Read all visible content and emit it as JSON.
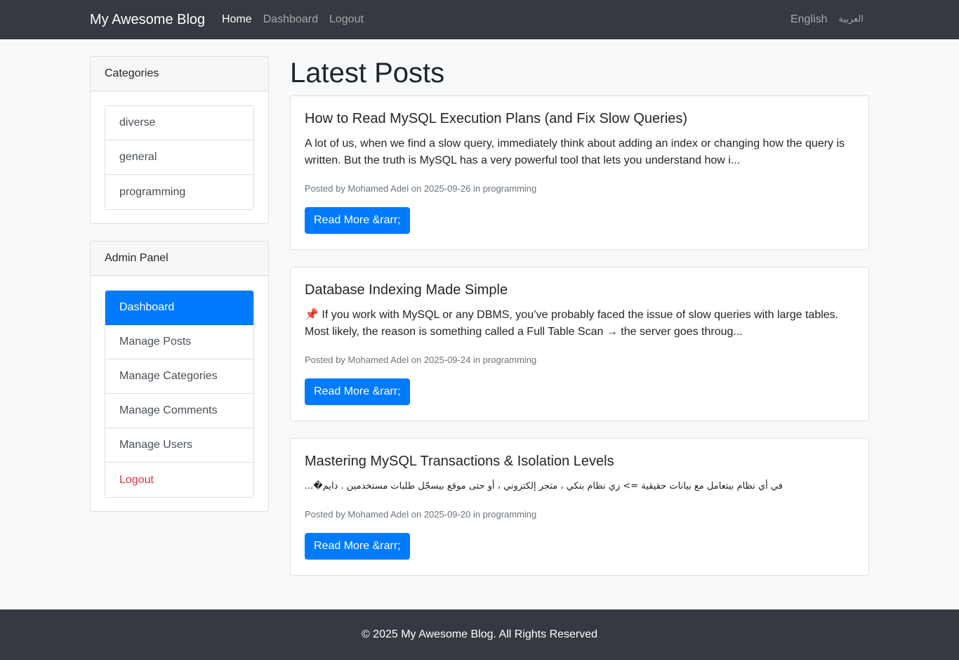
{
  "navbar": {
    "brand": "My Awesome Blog",
    "links": {
      "home": "Home",
      "dashboard": "Dashboard",
      "logout": "Logout"
    },
    "lang": {
      "english": "English",
      "arabic": "العربية"
    }
  },
  "sidebar": {
    "categories": {
      "title": "Categories",
      "items": [
        "diverse",
        "general",
        "programming"
      ]
    },
    "admin": {
      "title": "Admin Panel",
      "items": [
        "Dashboard",
        "Manage Posts",
        "Manage Categories",
        "Manage Comments",
        "Manage Users",
        "Logout"
      ]
    }
  },
  "main": {
    "title": "Latest Posts",
    "read_more": "Read More &rarr;",
    "posts": [
      {
        "title": "How to Read MySQL Execution Plans (and Fix Slow Queries)",
        "excerpt": "A lot of us, when we find a slow query, immediately think about adding an index or changing how the query is written. But the truth is MySQL has a very powerful tool that lets you understand how i...",
        "meta": "Posted by Mohamed Adel on 2025-09-26 in programming"
      },
      {
        "title": "Database Indexing Made Simple",
        "excerpt": "📌 If you work with MySQL or any DBMS, you’ve probably faced the issue of slow queries with large tables. Most likely, the reason is something called a Full Table Scan → the server goes throug...",
        "meta": "Posted by Mohamed Adel on 2025-09-24 in programming"
      },
      {
        "title": "Mastering MySQL Transactions & Isolation Levels",
        "excerpt": "في أي نظام بيتعامل مع بيانات حقيقية => زي نظام بنكي ، متجر إلكتروني ، أو حتى موقع بيسجّل طلبات مستخدمين . دايم�...",
        "meta": "Posted by Mohamed Adel on 2025-09-20 in programming"
      }
    ]
  },
  "footer": {
    "text": "© 2025 My Awesome Blog. All Rights Reserved"
  }
}
